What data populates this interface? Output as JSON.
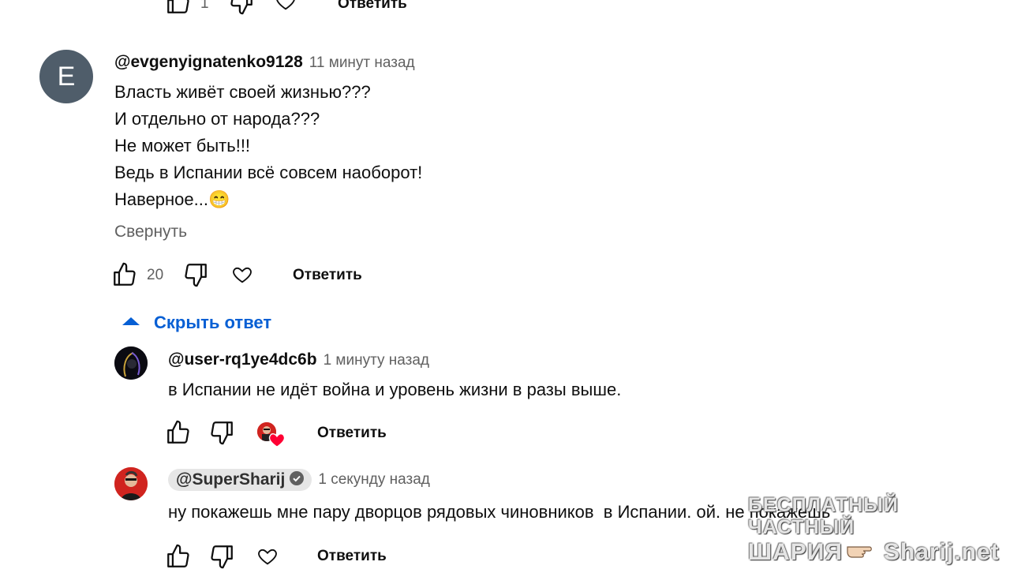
{
  "top_actions": {
    "like_count": "1",
    "reply_label": "Ответить"
  },
  "comment": {
    "avatar_letter": "E",
    "avatar_color": "#4f5d6a",
    "handle": "@evgenyignatenko9128",
    "time": "11 минут назад",
    "lines": [
      "Власть живёт своей жизнью???",
      "И отдельно от народа???",
      "Не может быть!!!",
      "Ведь в Испании всё совсем наоборот!",
      "Наверное..."
    ],
    "emoji": "😁",
    "collapse_label": "Свернуть",
    "like_count": "20",
    "reply_label": "Ответить"
  },
  "replies_toggle": {
    "label": "Скрыть ответ",
    "color": "#065fd4"
  },
  "replies": [
    {
      "handle": "@user-rq1ye4dc6b",
      "time": "1 минуту назад",
      "text": "в Испании не идёт война и уровень жизни в разы выше.",
      "reply_label": "Ответить",
      "hearted_by_creator": true
    },
    {
      "handle": "@SuperSharij",
      "time": "1 секунду назад",
      "text": "ну покажешь мне пару дворцов рядовых чиновников  в Испании. ой. не покажешь",
      "reply_label": "Ответить",
      "verified": true
    }
  ],
  "watermark": {
    "line1": "БЕСПЛАТНЫЙ ЧАСТНЫЙ",
    "line2_left": "ШАРИЯ",
    "line2_right": "Sharij.net"
  }
}
